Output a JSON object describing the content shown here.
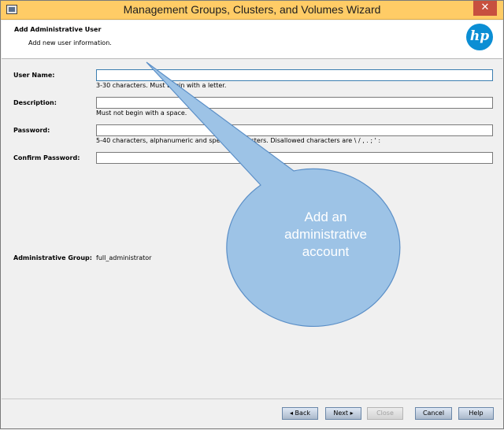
{
  "window": {
    "title": "Management Groups, Clusters, and Volumes Wizard",
    "close_glyph": "✕"
  },
  "header": {
    "title": "Add Administrative User",
    "subtitle": "Add new user information.",
    "logo_text": "hp"
  },
  "form": {
    "user_name": {
      "label": "User Name:",
      "value": "",
      "hint": "3-30 characters. Must begin with a letter."
    },
    "description": {
      "label": "Description:",
      "value": "",
      "hint": "Must not begin with a space."
    },
    "password": {
      "label": "Password:",
      "value": "",
      "hint": "5-40 characters, alphanumeric and special characters. Disallowed characters are \\ / , . ; ' :"
    },
    "confirm_password": {
      "label": "Confirm Password:",
      "value": ""
    },
    "admin_group": {
      "label": "Administrative Group:",
      "value": "full_administrator"
    }
  },
  "callout": {
    "text_lines": [
      "Add an",
      "administrative",
      "account"
    ],
    "fill_color": "#9dc3e6",
    "stroke_color": "#5b8fc7"
  },
  "buttons": {
    "back": "◂ Back",
    "next": "Next ▸",
    "close": "Close",
    "cancel": "Cancel",
    "help": "Help"
  }
}
